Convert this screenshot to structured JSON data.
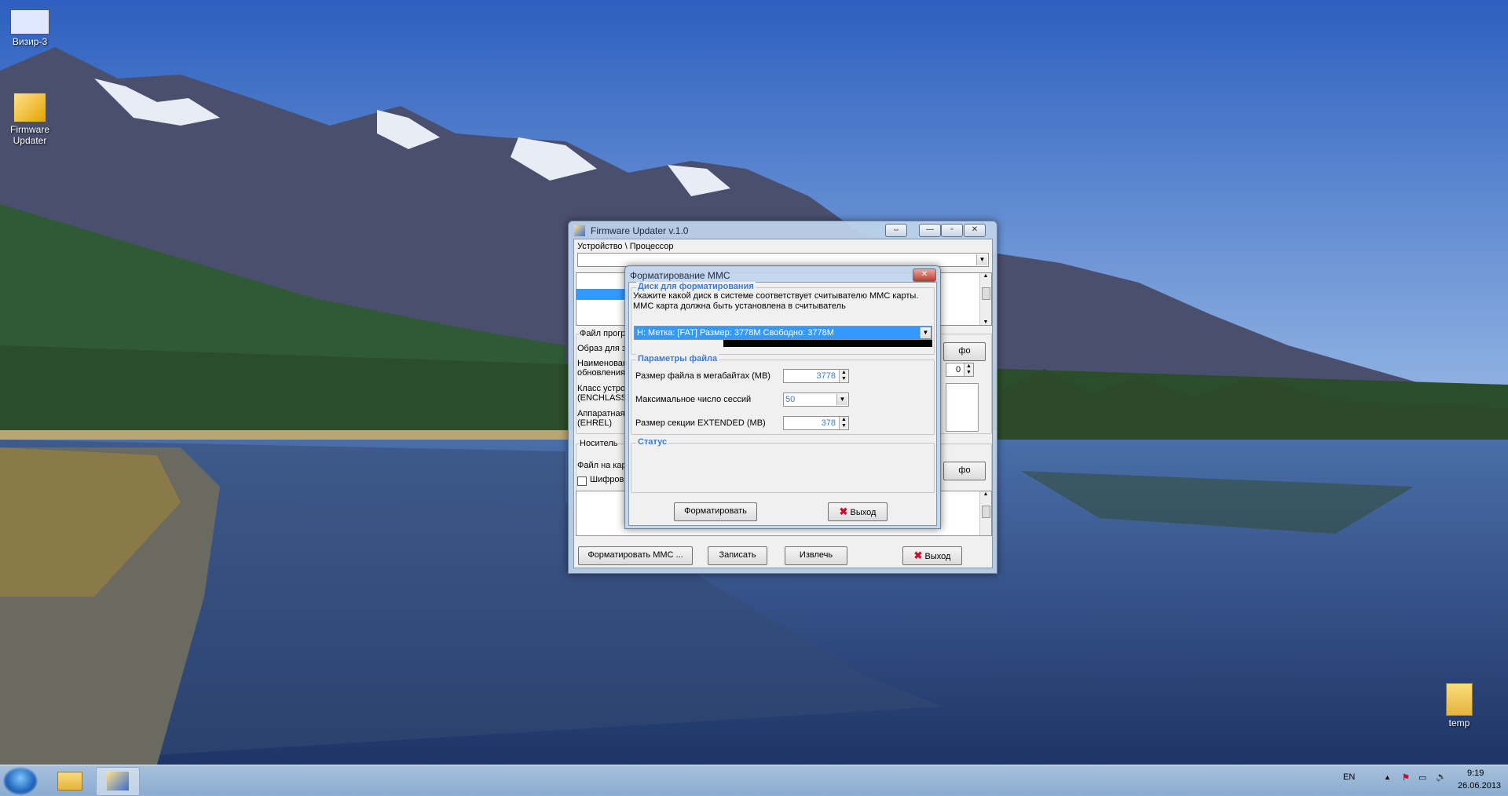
{
  "desktop": {
    "icons": [
      {
        "label": "Визир-3"
      },
      {
        "label": "Firmware Updater"
      },
      {
        "label": "temp"
      }
    ]
  },
  "main_window": {
    "title": "Firmware Updater v.1.0",
    "device_label": "Устройство \\ Процессор",
    "file_group_label": "Файл прогр",
    "image_label": "Образ для з",
    "name_label": "Наименован обновления",
    "class_label": "Класс устро (ENCHLASS)",
    "hw_label": "Аппаратная (EHREL)",
    "media_label": "Носитель",
    "card_file_label": "Файл на кар",
    "encrypt_label": "Шифров",
    "info_btn_1": "фо",
    "info_btn_2": "фо",
    "spin_value": "0",
    "buttons": {
      "format_mmc": "Форматировать MMC ...",
      "write": "Записать",
      "extract": "Извлечь",
      "exit": "Выход"
    }
  },
  "dialog": {
    "title": "Форматирование MMC",
    "disk_group": "Диск для форматирования",
    "disk_hint": "Укажите какой диск в системе соответствует считывателю MMC карты. MMC карта должна быть установлена в считыватель",
    "disk_selected": "H:  Метка: [FAT]  Размер: 3778M  Свободно: 3778M",
    "params_group": "Параметры файла",
    "file_size_label": "Размер файла в мегабайтах (MB)",
    "file_size_value": "3778",
    "max_sessions_label": "Максимальное число сессий",
    "max_sessions_value": "50",
    "extended_label": "Размер секции EXTENDED (MB)",
    "extended_value": "378",
    "status_group": "Статус",
    "format_btn": "Форматировать",
    "exit_btn": "Выход"
  },
  "tray": {
    "lang": "EN",
    "time": "9:19",
    "date": "26.06.2013"
  }
}
